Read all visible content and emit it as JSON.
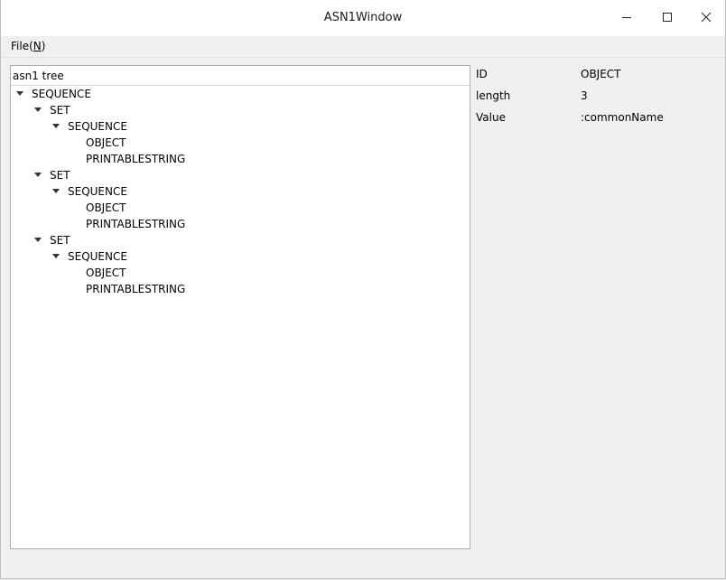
{
  "window": {
    "title": "ASN1Window"
  },
  "menu": {
    "file_prefix": "File(",
    "file_mnemonic": "N",
    "file_suffix": ")"
  },
  "tree": {
    "header": "asn1 tree",
    "selected_index": 14,
    "rows": [
      {
        "label": "SEQUENCE",
        "depth": 0,
        "expanded": true
      },
      {
        "label": "SET",
        "depth": 1,
        "expanded": true
      },
      {
        "label": "SEQUENCE",
        "depth": 2,
        "expanded": true
      },
      {
        "label": "OBJECT",
        "depth": 3,
        "expanded": null
      },
      {
        "label": "PRINTABLESTRING",
        "depth": 3,
        "expanded": null
      },
      {
        "label": "SET",
        "depth": 1,
        "expanded": true
      },
      {
        "label": "SEQUENCE",
        "depth": 2,
        "expanded": true
      },
      {
        "label": "OBJECT",
        "depth": 3,
        "expanded": null
      },
      {
        "label": "PRINTABLESTRING",
        "depth": 3,
        "expanded": null
      },
      {
        "label": "SET",
        "depth": 1,
        "expanded": true
      },
      {
        "label": "SEQUENCE",
        "depth": 2,
        "expanded": true
      },
      {
        "label": "OBJECT",
        "depth": 3,
        "expanded": null
      },
      {
        "label": "PRINTABLESTRING",
        "depth": 3,
        "expanded": null
      }
    ]
  },
  "properties": [
    {
      "key": "ID",
      "value": "OBJECT"
    },
    {
      "key": "length",
      "value": "3"
    },
    {
      "key": "Value",
      "value": ":commonName"
    }
  ],
  "colors": {
    "selection": "#308cc6",
    "selection_text": "#ffffff"
  },
  "icons": {
    "minimize": "minimize-icon",
    "maximize": "maximize-icon",
    "close": "close-icon",
    "expand": "chevron-down-icon"
  }
}
